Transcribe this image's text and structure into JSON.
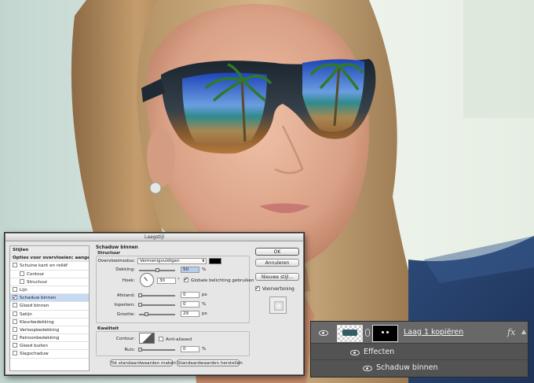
{
  "dialog": {
    "title": "Laagstijl",
    "styles_list": [
      {
        "label": "Stijlen",
        "kind": "header"
      },
      {
        "label": "Opties voor overvloeien: aangepast",
        "kind": "header"
      },
      {
        "label": "Schuine kant en reliëf",
        "kind": "check",
        "checked": false
      },
      {
        "label": "Contour",
        "kind": "check",
        "checked": false,
        "indent": true
      },
      {
        "label": "Structuur",
        "kind": "check",
        "checked": false,
        "indent": true
      },
      {
        "label": "Lijn",
        "kind": "check",
        "checked": false
      },
      {
        "label": "Schaduw binnen",
        "kind": "check",
        "checked": true,
        "selected": true
      },
      {
        "label": "Gloed binnen",
        "kind": "check",
        "checked": false
      },
      {
        "label": "Satijn",
        "kind": "check",
        "checked": false
      },
      {
        "label": "Kleurbedekking",
        "kind": "check",
        "checked": false
      },
      {
        "label": "Verloopbedekking",
        "kind": "check",
        "checked": false
      },
      {
        "label": "Patroonbedekking",
        "kind": "check",
        "checked": false
      },
      {
        "label": "Gloed buiten",
        "kind": "check",
        "checked": false
      },
      {
        "label": "Slagschaduw",
        "kind": "check",
        "checked": false
      }
    ],
    "panel": {
      "section_title": "Schaduw binnen",
      "structure_title": "Structuur",
      "blend_mode_label": "Overvloeimodus:",
      "blend_mode_value": "Vermenigvuldigen",
      "shadow_color": "#000000",
      "opacity_label": "Dekking:",
      "opacity_value": "50",
      "opacity_unit": "%",
      "opacity_level": 50,
      "angle_label": "Hoek:",
      "angle_value": "30",
      "angle_unit": "°",
      "global_light_label": "Globale belichting gebruiken",
      "global_light_checked": true,
      "distance_label": "Afstand:",
      "distance_value": "0",
      "distance_unit": "px",
      "choke_label": "Inperken:",
      "choke_value": "0",
      "choke_unit": "%",
      "size_label": "Grootte:",
      "size_value": "29",
      "size_unit": "px",
      "quality_title": "Kwaliteit",
      "contour_label": "Contour:",
      "anti_alias_label": "Anti-aliased",
      "anti_alias_checked": false,
      "noise_label": "Ruis:",
      "noise_value": "0",
      "noise_unit": "%",
      "make_default_label": "Tot standaardwaarden maken",
      "reset_default_label": "Standaardwaarden herstellen"
    },
    "buttons": {
      "ok": "OK",
      "cancel": "Annuleren",
      "new_style": "Nieuwe stijl...",
      "preview_label": "Voorvertoning",
      "preview_checked": true
    }
  },
  "layers": {
    "layer_name": "Laag 1 kopiëren",
    "fx_label": "fx",
    "effects_label": "Effecten",
    "effect_item": "Schaduw binnen"
  }
}
